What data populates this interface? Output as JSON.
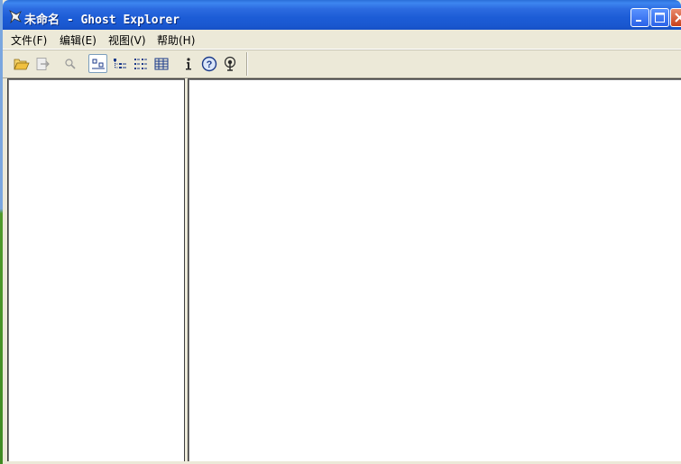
{
  "window": {
    "title": "未命名 - Ghost Explorer"
  },
  "menubar": {
    "items": [
      {
        "label": "文件(F)"
      },
      {
        "label": "编辑(E)"
      },
      {
        "label": "视图(V)"
      },
      {
        "label": "帮助(H)"
      }
    ]
  },
  "toolbar": {
    "buttons": [
      {
        "icon": "open-folder-icon"
      },
      {
        "icon": "extract-icon"
      },
      {
        "icon": "search-icon"
      },
      {
        "icon": "large-icons-view-icon",
        "pressed": true
      },
      {
        "icon": "tree-view-icon"
      },
      {
        "icon": "list-view-icon"
      },
      {
        "icon": "details-view-icon"
      },
      {
        "icon": "info-icon"
      },
      {
        "icon": "help-icon"
      },
      {
        "icon": "network-icon"
      }
    ]
  },
  "colors": {
    "titlebar": "#1c5cd6",
    "window_face": "#ece9d8",
    "pane_bg": "#ffffff",
    "close_button": "#c8401c"
  }
}
